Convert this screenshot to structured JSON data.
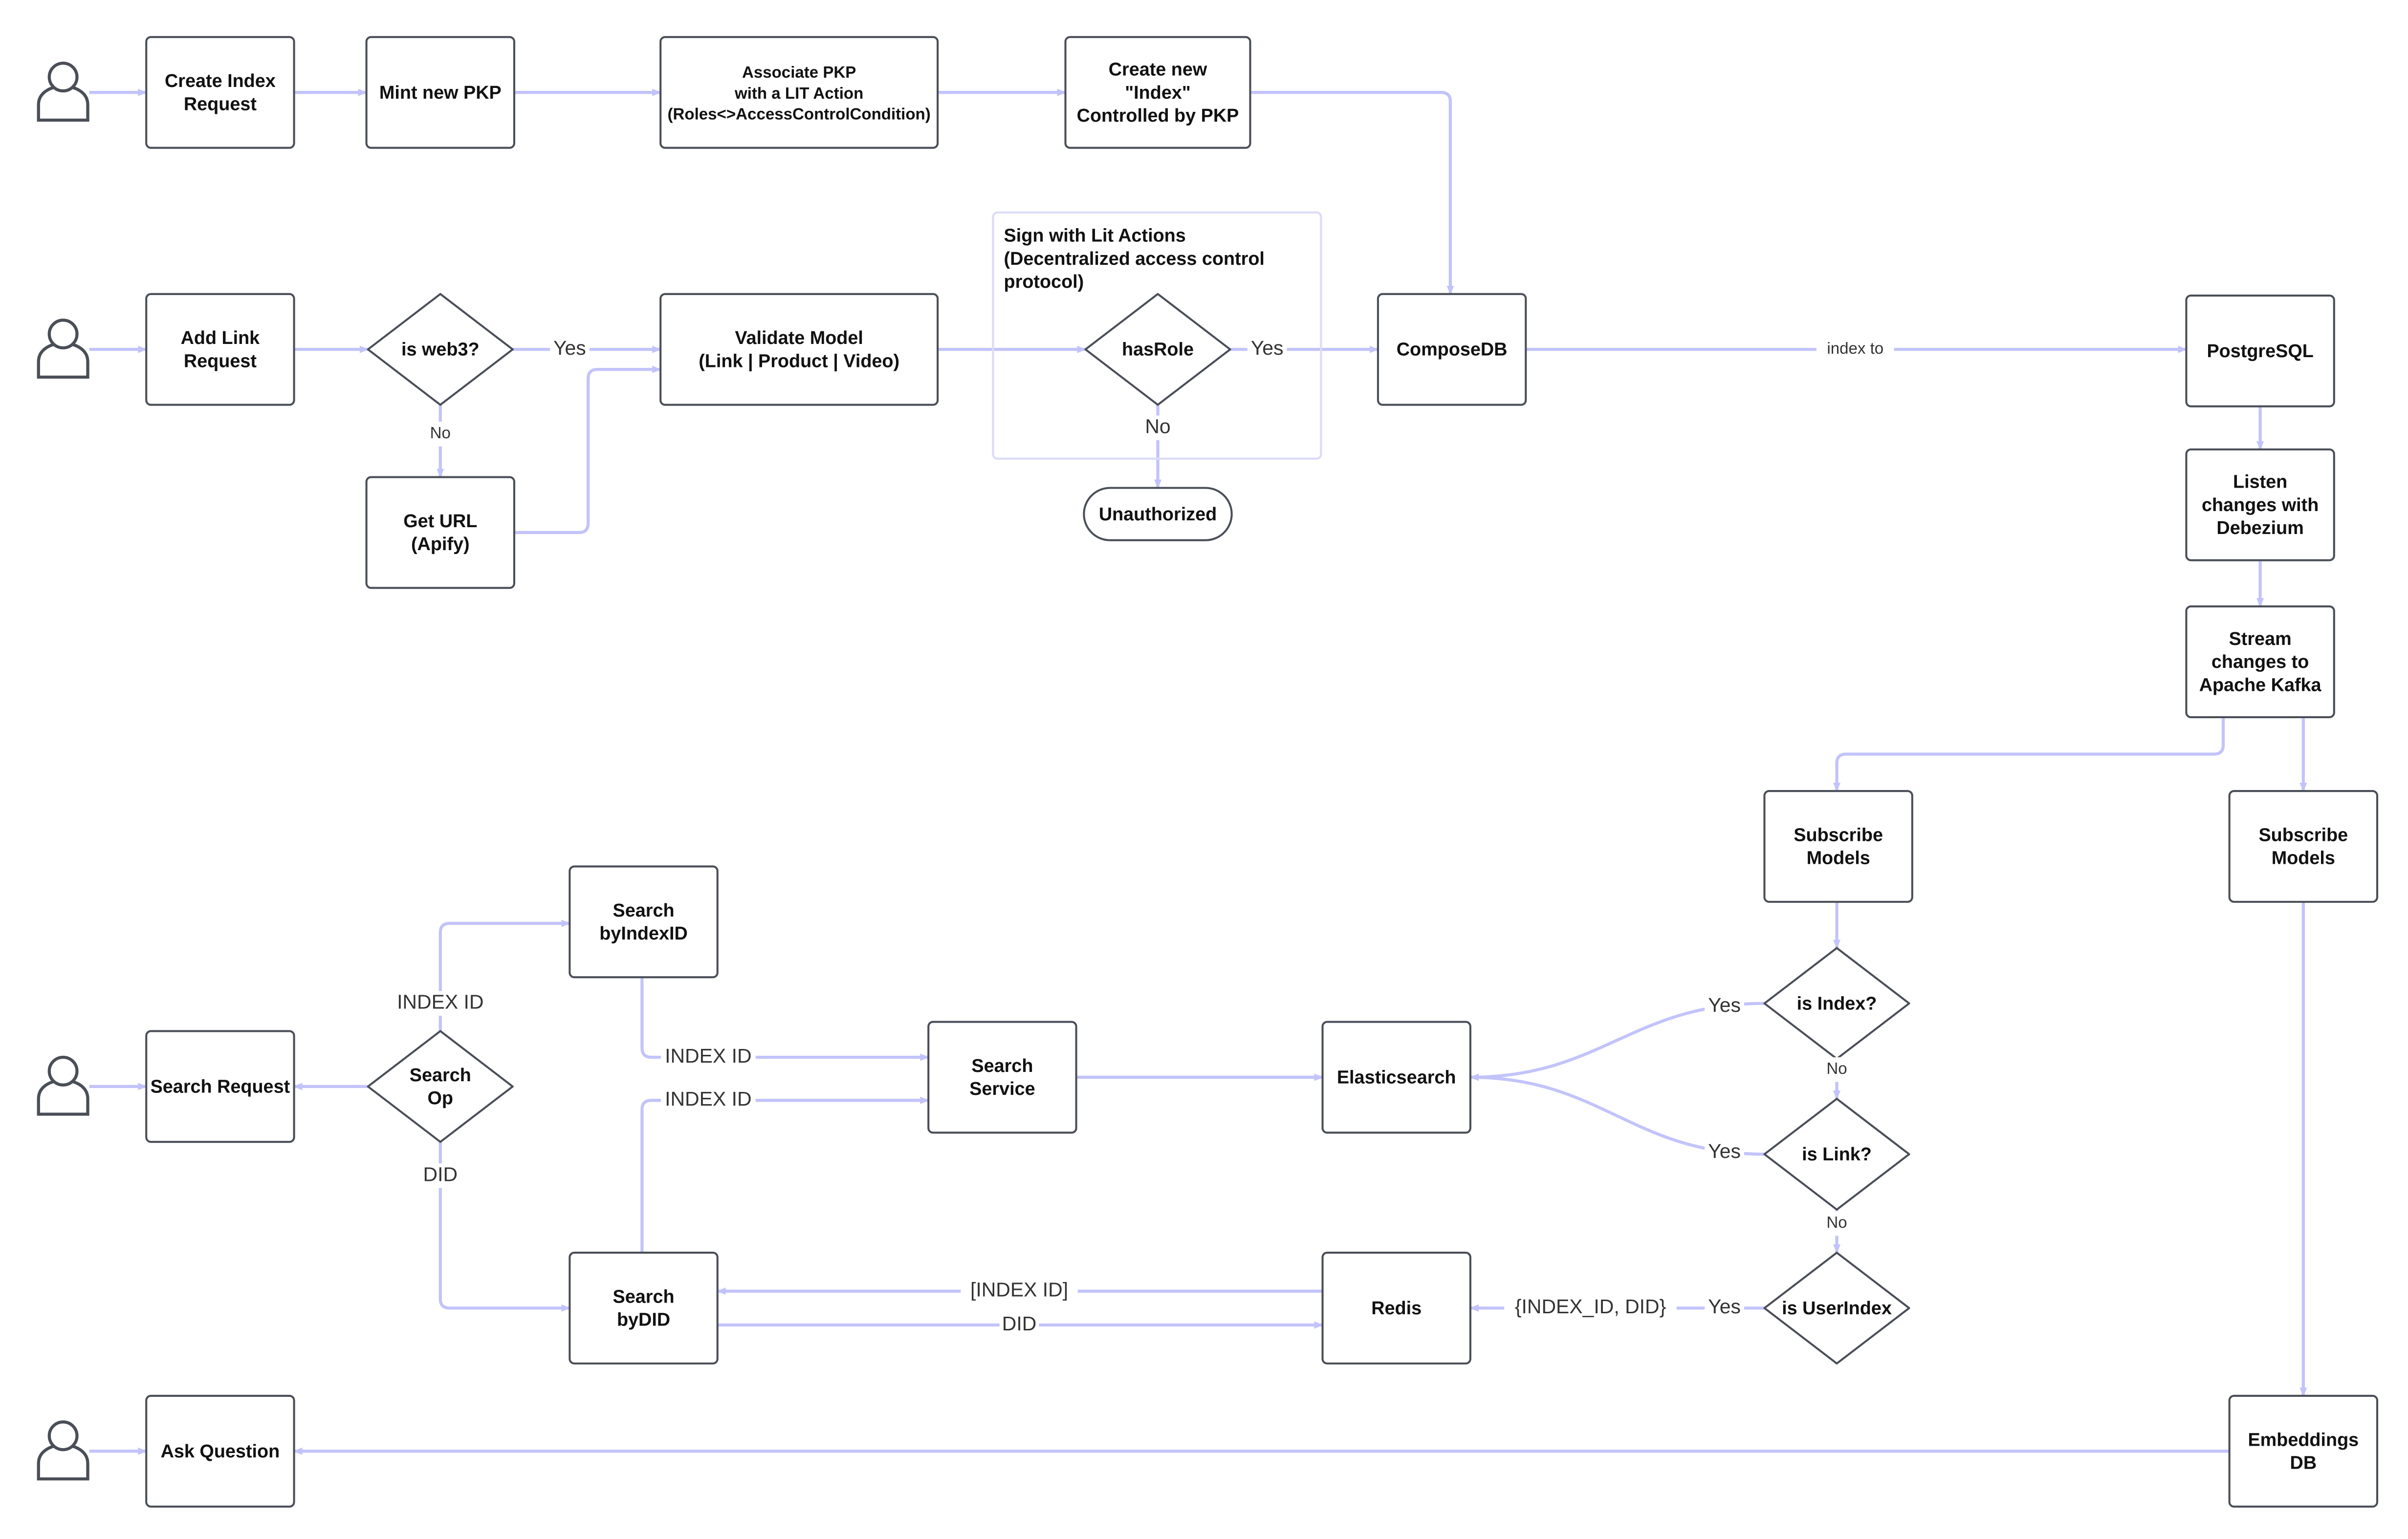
{
  "colors": {
    "edge": "#c3c3fb",
    "node_border": "#4a4e57",
    "group_border": "#dcdcf8",
    "text": "#111111"
  },
  "icons": {
    "actor": "person-icon"
  },
  "nodes": {
    "create_index": {
      "lines": [
        "Create Index",
        "Request"
      ]
    },
    "mint_pkp": {
      "lines": [
        "Mint new PKP"
      ]
    },
    "associate_pkp": {
      "lines": [
        "Associate PKP",
        "with a LIT Action",
        "(Roles<>AccessControlCondition)"
      ]
    },
    "create_new_index": {
      "lines": [
        "Create new",
        "\"Index\"",
        "Controlled by PKP"
      ]
    },
    "add_link": {
      "lines": [
        "Add Link",
        "Request"
      ]
    },
    "is_web3": {
      "lines": [
        "is web3?"
      ]
    },
    "get_url": {
      "lines": [
        "Get URL",
        "(Apify)"
      ]
    },
    "validate_model": {
      "lines": [
        "Validate  Model",
        "(Link | Product | Video)"
      ]
    },
    "has_role": {
      "lines": [
        "hasRole"
      ]
    },
    "unauthorized": {
      "lines": [
        "Unauthorized"
      ]
    },
    "composedb": {
      "lines": [
        "ComposeDB"
      ]
    },
    "postgresql": {
      "lines": [
        "PostgreSQL"
      ]
    },
    "listen_changes": {
      "lines": [
        "Listen",
        "changes with",
        "Debezium"
      ]
    },
    "stream_changes": {
      "lines": [
        "Stream",
        "changes to",
        "Apache Kafka"
      ]
    },
    "subscribe_models_1": {
      "lines": [
        "Subscribe",
        "Models"
      ]
    },
    "subscribe_models_2": {
      "lines": [
        "Subscribe",
        "Models"
      ]
    },
    "is_index": {
      "lines": [
        "is Index?"
      ]
    },
    "is_link": {
      "lines": [
        "is Link?"
      ]
    },
    "is_userindex": {
      "lines": [
        "is UserIndex"
      ]
    },
    "elasticsearch": {
      "lines": [
        "Elasticsearch"
      ]
    },
    "search_service": {
      "lines": [
        "Search",
        "Service"
      ]
    },
    "search_byindexid": {
      "lines": [
        "Search",
        "byIndexID"
      ]
    },
    "search_op": {
      "lines": [
        "Search",
        "Op"
      ]
    },
    "search_request": {
      "lines": [
        "Search Request"
      ]
    },
    "search_bydid": {
      "lines": [
        "Search",
        "byDID"
      ]
    },
    "redis": {
      "lines": [
        "Redis"
      ]
    },
    "ask_question": {
      "lines": [
        "Ask Question"
      ]
    },
    "embeddings_db": {
      "lines": [
        "Embeddings",
        "DB"
      ]
    }
  },
  "group": {
    "title_lines": [
      "Sign with Lit Actions",
      "(Decentralized access control",
      "protocol)"
    ]
  },
  "edge_labels": {
    "web3_yes": "Yes",
    "web3_no": "No",
    "hasrole_yes": "Yes",
    "hasrole_no": "No",
    "index_to": "index to",
    "isindex_yes": "Yes",
    "isindex_no": "No",
    "islink_yes": "Yes",
    "islink_no": "No",
    "isuserindex_yes": "Yes",
    "index_id_did": "{INDEX_ID, DID}",
    "byindexid_out": "INDEX ID",
    "bydid_out": "INDEX ID",
    "redis_to_bydid": "[INDEX ID]",
    "bydid_to_redis": "DID",
    "searchop_index": "INDEX ID",
    "searchop_did": "DID"
  }
}
